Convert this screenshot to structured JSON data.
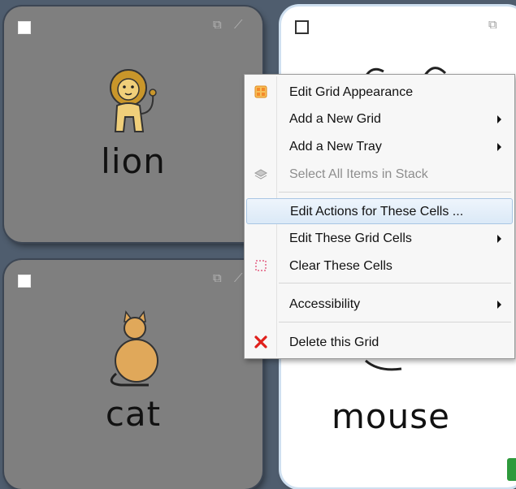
{
  "cells": {
    "lion": {
      "word": "lion"
    },
    "mouse": {
      "word": "mouse"
    },
    "cat": {
      "word": "cat"
    }
  },
  "context_menu": {
    "items": [
      {
        "label": "Edit Grid Appearance",
        "icon": "grid-appearance-icon",
        "submenu": false,
        "disabled": false
      },
      {
        "label": "Add a New Grid",
        "icon": "",
        "submenu": true,
        "disabled": false
      },
      {
        "label": "Add a New Tray",
        "icon": "",
        "submenu": true,
        "disabled": false
      },
      {
        "label": "Select All Items in Stack",
        "icon": "stack-icon",
        "submenu": false,
        "disabled": true
      },
      {
        "label": "Edit Actions for These Cells ...",
        "icon": "",
        "submenu": false,
        "disabled": false,
        "highlighted": true
      },
      {
        "label": "Edit These Grid Cells",
        "icon": "",
        "submenu": true,
        "disabled": false
      },
      {
        "label": "Clear These Cells",
        "icon": "clear-cells-icon",
        "submenu": false,
        "disabled": false
      },
      {
        "label": "Accessibility",
        "icon": "",
        "submenu": true,
        "disabled": false
      },
      {
        "label": "Delete this Grid",
        "icon": "delete-x-icon",
        "submenu": false,
        "disabled": false
      }
    ]
  },
  "colors": {
    "background": "#4f5d6e",
    "cell_grey": "#7f7f7f",
    "menu_highlight": "#dbe9f7",
    "delete_red": "#e0201b",
    "status_green": "#2e9a3c"
  }
}
